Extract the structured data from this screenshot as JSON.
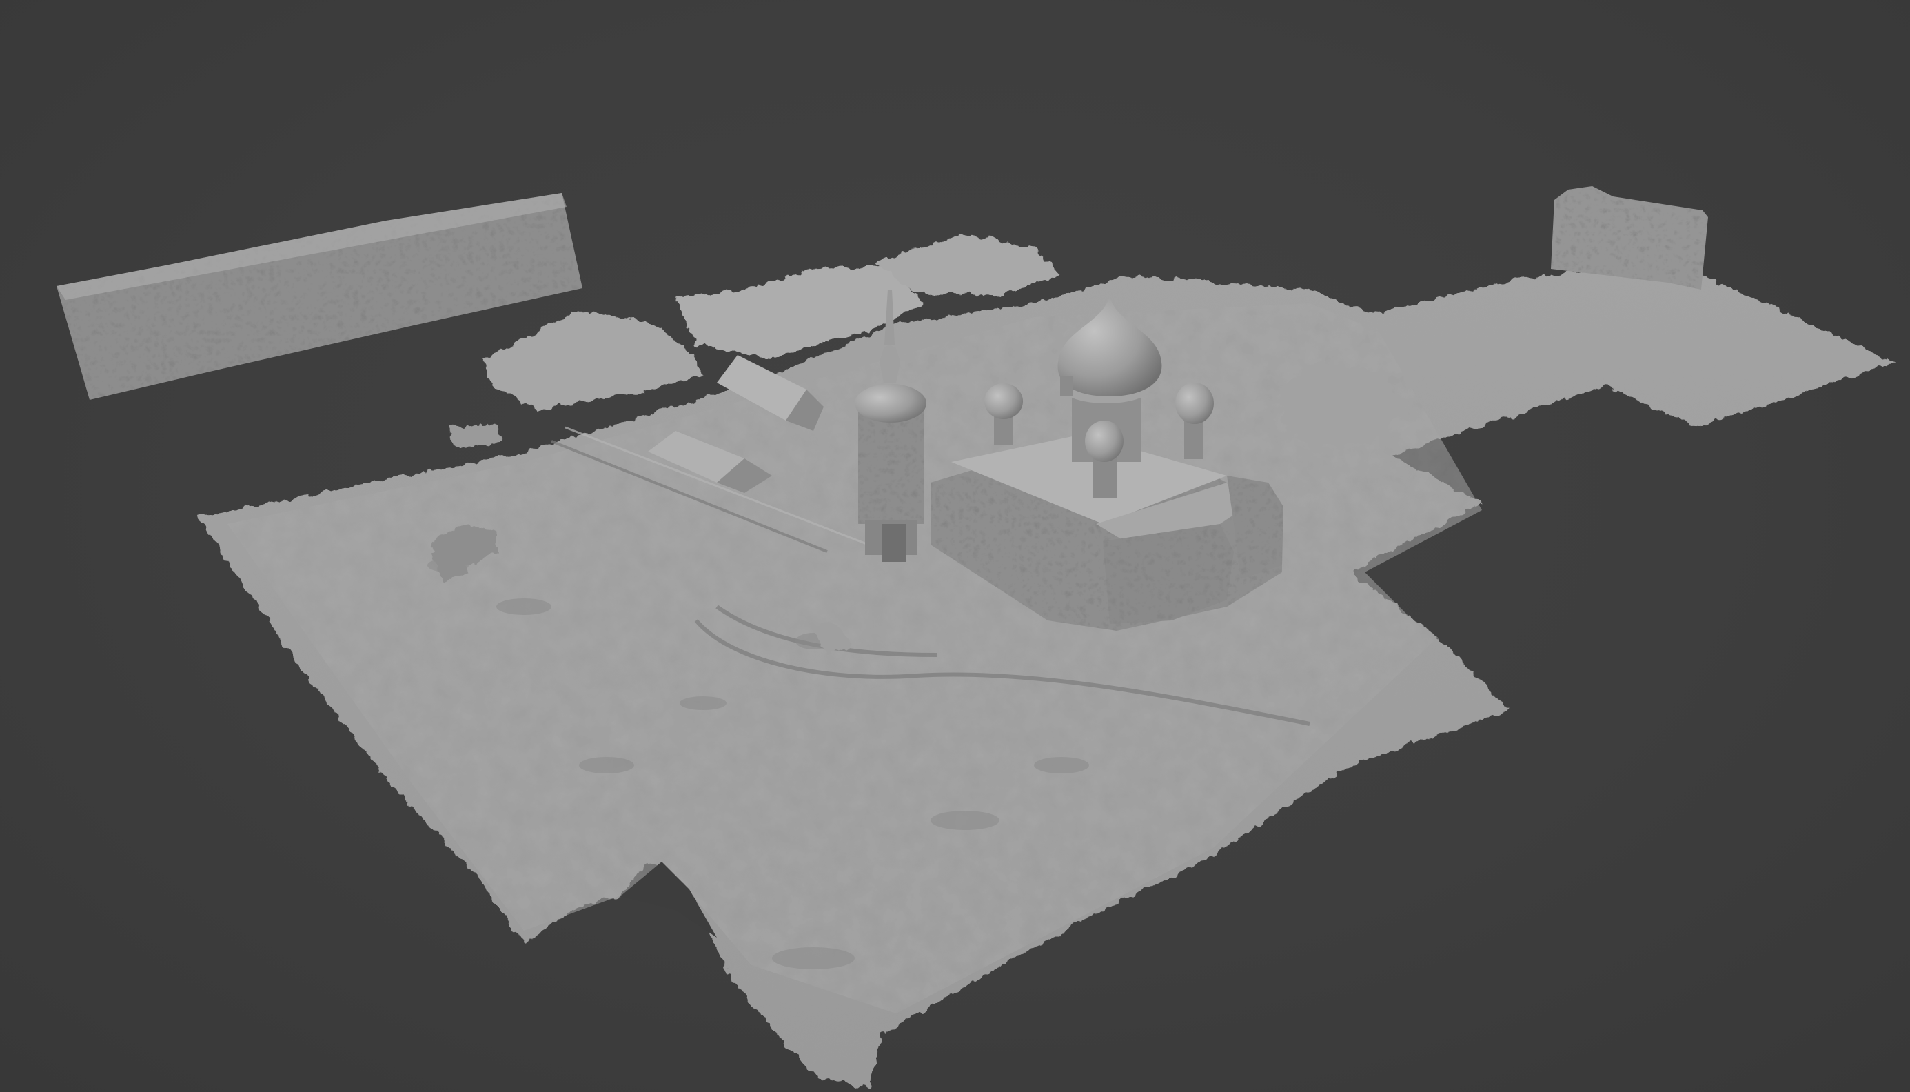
{
  "viewport": {
    "background_color": "#3d3d3d",
    "mesh_color": "#9a9a9a",
    "shading": "solid-matcap-gray"
  },
  "scene": {
    "objects": [
      "terrain-mesh",
      "church-building",
      "main-onion-dome",
      "small-onion-domes",
      "bell-tower",
      "stone-wall-fragment",
      "ruined-wall-fragment",
      "small-sheds",
      "rock-mounds"
    ]
  }
}
